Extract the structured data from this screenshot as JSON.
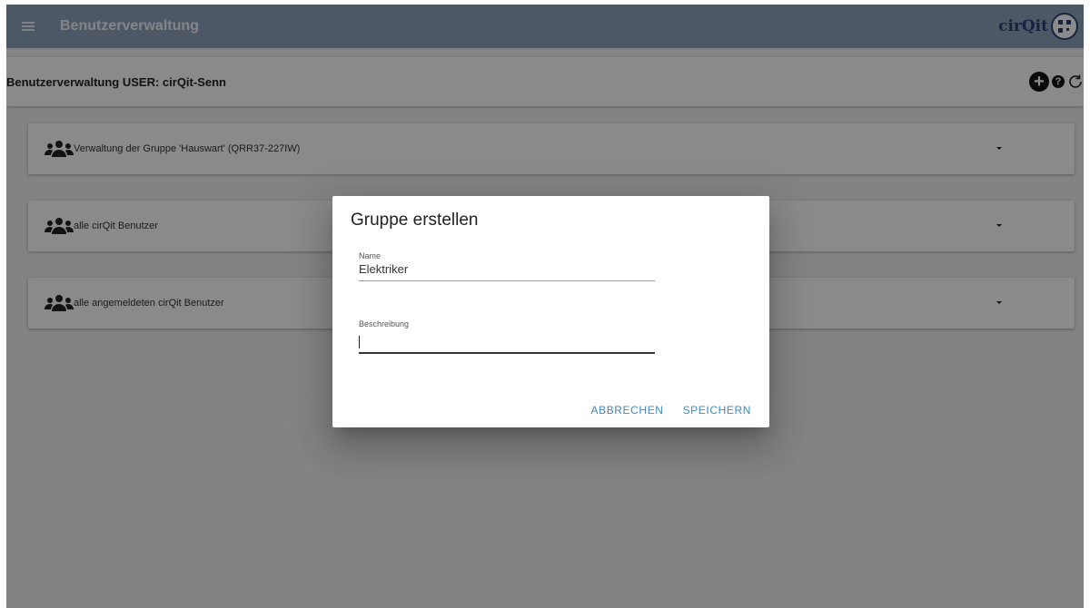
{
  "app": {
    "title": "Benutzerverwaltung",
    "logo_text": "cirQit"
  },
  "subheader": {
    "title": "Benutzerverwaltung USER: cirQit-Senn"
  },
  "groups": [
    {
      "label": "Verwaltung der Gruppe 'Hauswart' (QRR37-227IW)"
    },
    {
      "label": "alle cirQit Benutzer"
    },
    {
      "label": "alle angemeldeten cirQit Benutzer"
    }
  ],
  "dialog": {
    "title": "Gruppe erstellen",
    "name_label": "Name",
    "name_value": "Elektriker",
    "description_label": "Beschreibung",
    "description_value": "",
    "cancel_label": "ABBRECHEN",
    "save_label": "SPEICHERN"
  },
  "colors": {
    "topbar": "#8fa3bf",
    "accent": "#3b8bc4",
    "logo": "#2d3f73"
  },
  "icons": {
    "menu": "menu-icon",
    "add": "add-circle-icon",
    "help": "help-icon",
    "refresh": "refresh-icon",
    "group": "group-icon",
    "expand": "caret-down-icon"
  }
}
